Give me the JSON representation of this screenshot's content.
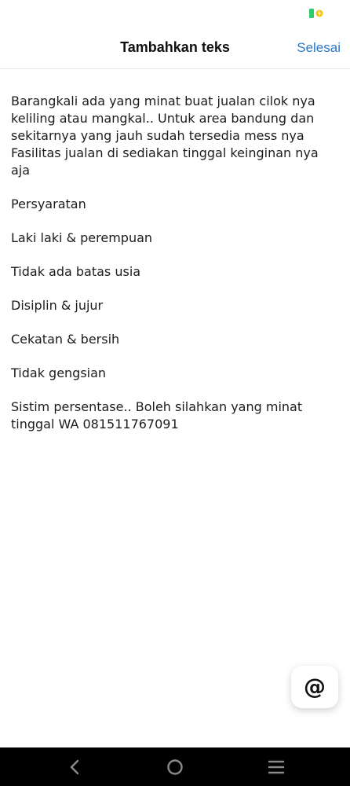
{
  "status_bar": {
    "battery_color": "#2ecc71",
    "charge_color": "#f1c40f",
    "icons": [
      "battery-icon",
      "charging-icon"
    ]
  },
  "header": {
    "title": "Tambahkan teks",
    "done_label": "Selesai",
    "done_color": "#2a78c8"
  },
  "editor": {
    "paragraphs": [
      "Barangkali ada yang minat buat jualan cilok nya keliling atau mangkal.. Untuk area bandung dan sekitarnya yang jauh sudah tersedia mess nya Fasilitas jualan di sediakan tinggal keinginan nya aja",
      "Persyaratan",
      "Laki laki & perempuan",
      "Tidak ada batas usia",
      "Disiplin & jujur",
      "Cekatan & bersih",
      "Tidak gengsian",
      "Sistim persentase.. Boleh silahkan yang minat tinggal WA 081511767091"
    ]
  },
  "mention_button": {
    "symbol": "@",
    "icon": "at-sign-icon"
  },
  "nav_bar": {
    "icons": [
      "back-icon",
      "home-icon",
      "menu-icon"
    ]
  }
}
